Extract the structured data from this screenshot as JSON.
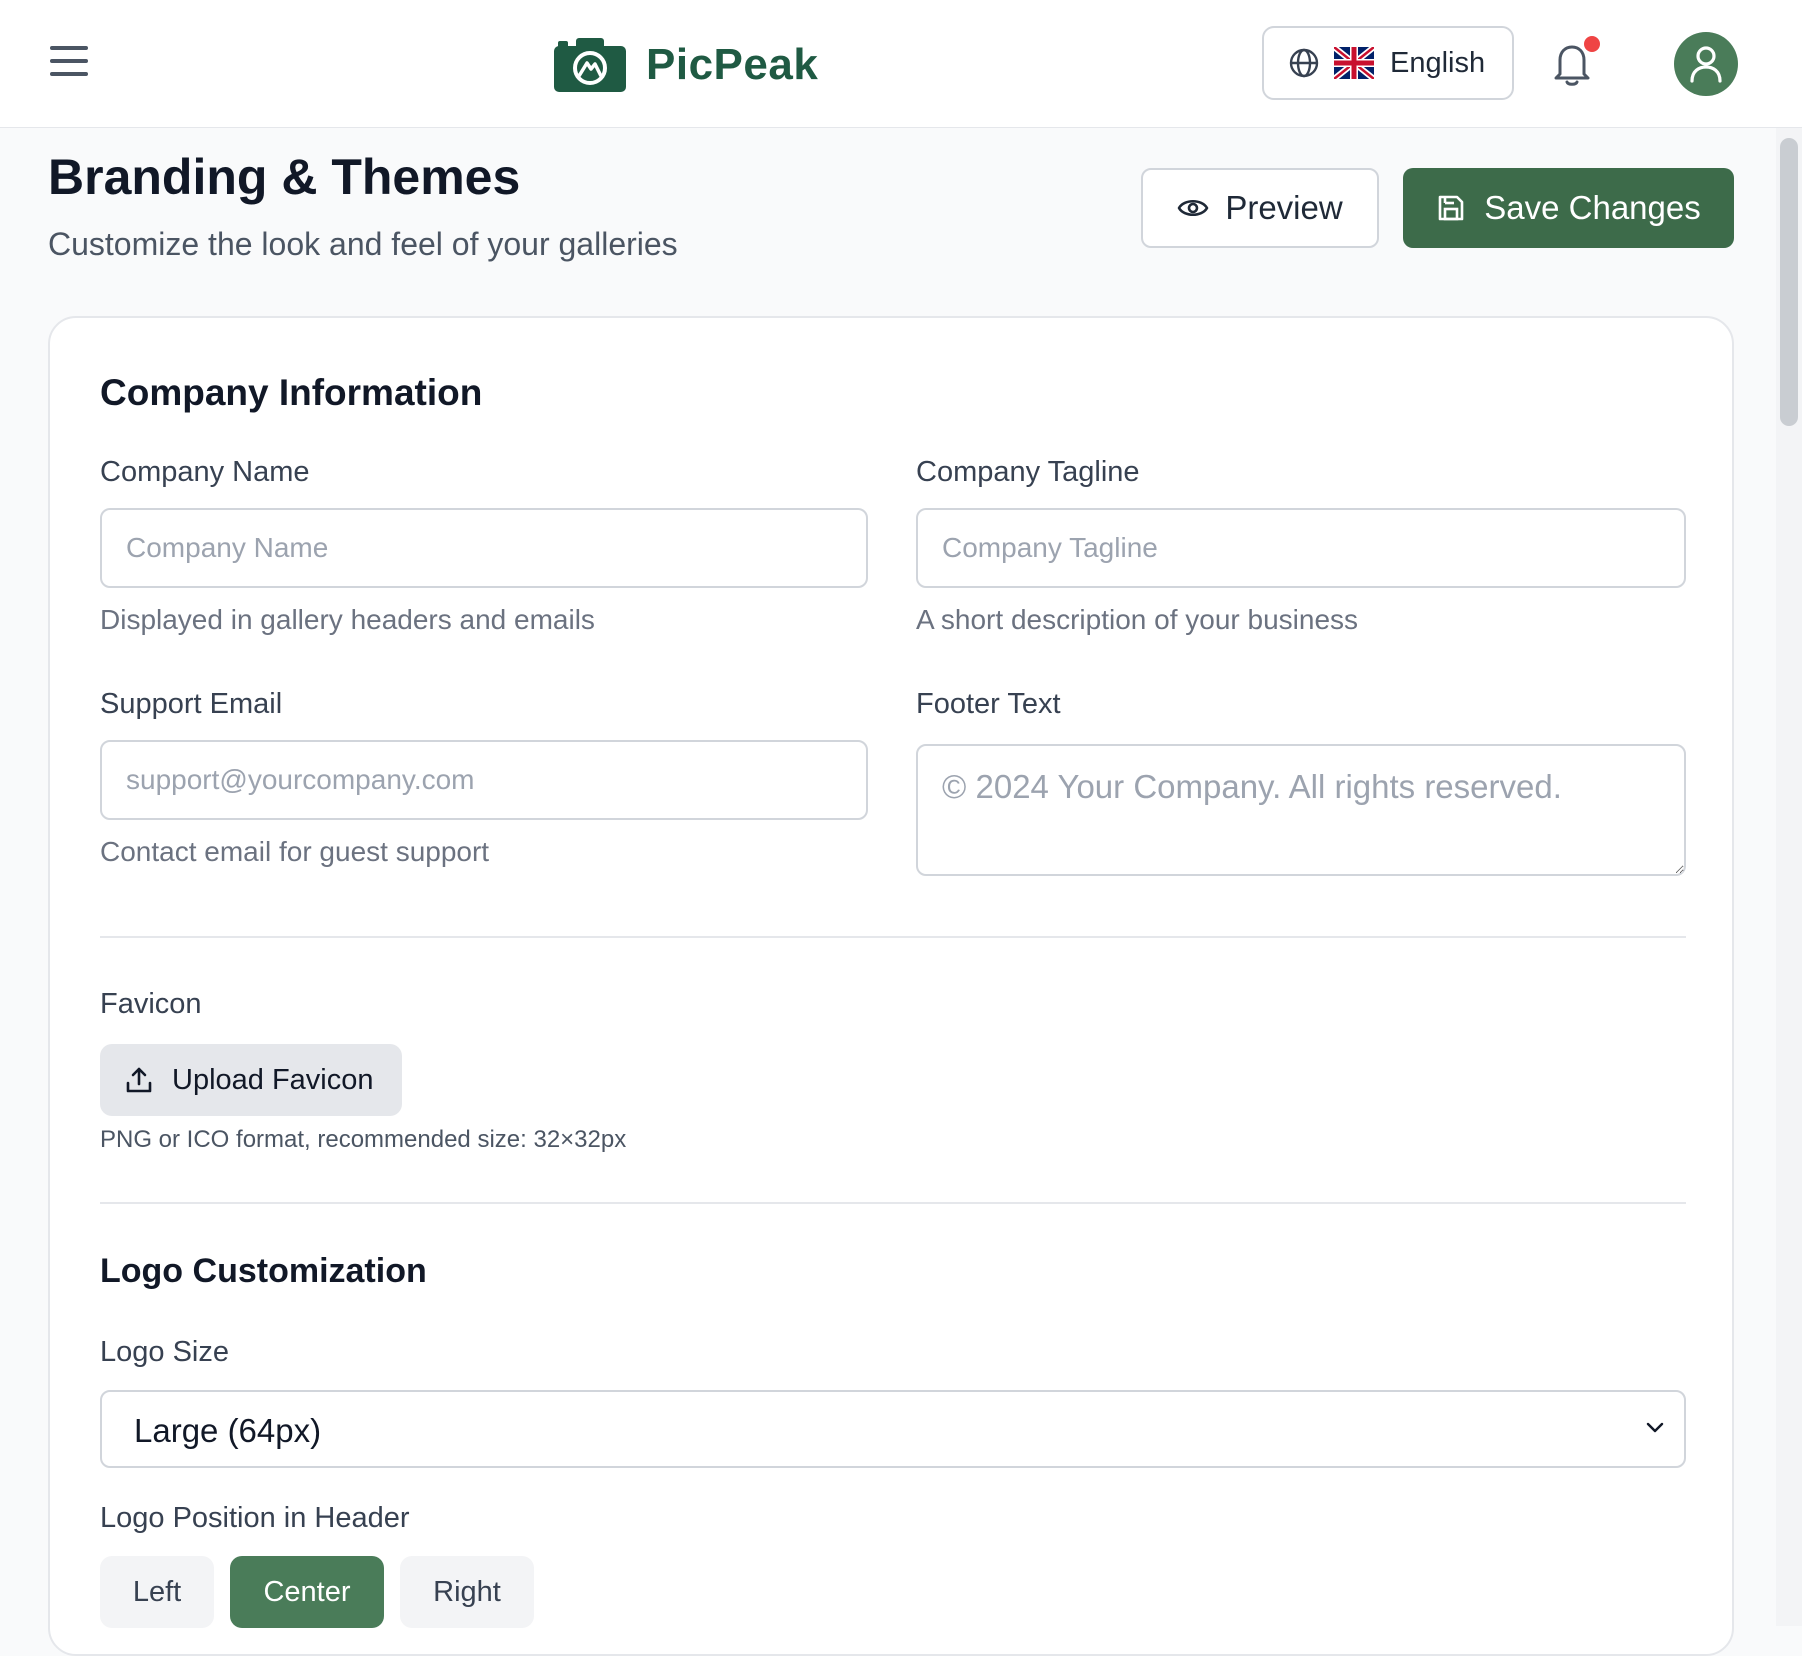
{
  "header": {
    "brand": "PicPeak",
    "language": "English",
    "colors": {
      "brand": "#1f5a43",
      "accent": "#3d6b4a",
      "notification": "#ef4444"
    }
  },
  "page": {
    "title": "Branding & Themes",
    "subtitle": "Customize the look and feel of your galleries",
    "preview_label": "Preview",
    "save_label": "Save Changes"
  },
  "company": {
    "section_title": "Company Information",
    "name": {
      "label": "Company Name",
      "placeholder": "Company Name",
      "value": "",
      "help": "Displayed in gallery headers and emails"
    },
    "tagline": {
      "label": "Company Tagline",
      "placeholder": "Company Tagline",
      "value": "",
      "help": "A short description of your business"
    },
    "email": {
      "label": "Support Email",
      "placeholder": "support@yourcompany.com",
      "value": "",
      "help": "Contact email for guest support"
    },
    "footer": {
      "label": "Footer Text",
      "placeholder": "© 2024 Your Company. All rights reserved.",
      "value": ""
    }
  },
  "favicon": {
    "label": "Favicon",
    "button_label": "Upload Favicon",
    "help": "PNG or ICO format, recommended size: 32×32px"
  },
  "logo": {
    "section_title": "Logo Customization",
    "size_label": "Logo Size",
    "size_value": "Large (64px)",
    "position_label": "Logo Position in Header",
    "positions": [
      "Left",
      "Center",
      "Right"
    ],
    "selected_position": "Center"
  }
}
